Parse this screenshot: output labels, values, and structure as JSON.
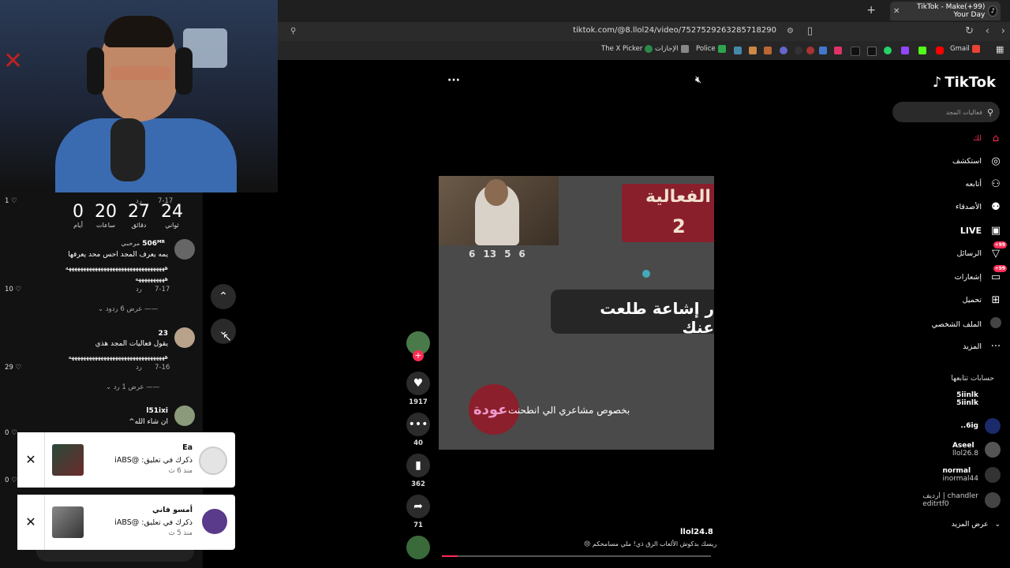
{
  "browser": {
    "tab_title": "(99+)TikTok - Make Your Day",
    "url": "tiktok.com/@8.llol24/video/7527529263285718290",
    "bookmarks": [
      "The X Picker",
      "الإجازات",
      "Police",
      "Gmail"
    ]
  },
  "webcam": {},
  "comments": {
    "countdown": [
      {
        "value": "24",
        "label": "ثواني"
      },
      {
        "value": "27",
        "label": "دقائق"
      },
      {
        "value": "20",
        "label": "ساعات"
      },
      {
        "value": "0",
        "label": "أيام"
      }
    ],
    "items": [
      {
        "top_date": "7-17",
        "reply": "رد",
        "likes": "1",
        "username": "506ᴹᴿ",
        "badge": "مرحبي",
        "line1": "يمه يعرف المجد احس محد يعرفها",
        "line2": "ههههههههههههههههههههههههههههههههههه",
        "line3": "ههههههههههه",
        "date": "7-17",
        "likes2": "10",
        "show_replies": "عرض 6 ردود"
      },
      {
        "username": "23",
        "line1": "يقول فعاليات المجد هذي",
        "line2": "هههههههههههههههههههههههههههههههههه",
        "date": "7-16",
        "reply": "رد",
        "likes": "29",
        "show_replies": "عرض 1 رد"
      },
      {
        "username": "l51ixi",
        "line1": "ان شاء الله^",
        "likes": "0"
      }
    ]
  },
  "notifications": [
    {
      "name": "Ea",
      "message": "ذكرك في تعليق: @iABS",
      "time": "منذ 6 ث"
    },
    {
      "name": "أمسو فاني",
      "message": "ذكرك في تعليق: @iABS",
      "time": "منذ 5 ث"
    }
  ],
  "video": {
    "title_line1": "الفعالية",
    "title_line2": "2",
    "countdown_small": [
      "6",
      "13",
      "5",
      "6"
    ],
    "bubble_text": "ر إشاعة طلعت عنك",
    "sticker_text": "عودة",
    "subtitle": "بخصوص مشاعري الي انطحنت",
    "author": "llol24.8",
    "description": "ريسك بدكوش الألعاب الزق ذي! ملي مسامحكم 😢",
    "progress": 0.06
  },
  "actions": {
    "likes": "1917",
    "comments": "40",
    "saves": "362",
    "shares": "71"
  },
  "sidebar": {
    "logo": "TikTok",
    "search_placeholder": "فعاليات المجد",
    "items": [
      {
        "label": "لك",
        "icon": "home-icon"
      },
      {
        "label": "استكشف",
        "icon": "compass-icon"
      },
      {
        "label": "أتابعه",
        "icon": "follow-icon"
      },
      {
        "label": "الأصدقاء",
        "icon": "friends-icon"
      },
      {
        "label": "LIVE",
        "icon": "live-icon"
      },
      {
        "label": "الرسائل",
        "icon": "messages-icon",
        "badge": "99+"
      },
      {
        "label": "إشعارات",
        "icon": "notifications-icon",
        "badge": "99+"
      },
      {
        "label": "تحميل",
        "icon": "upload-icon"
      },
      {
        "label": "الملف الشخصي",
        "icon": "profile-icon"
      },
      {
        "label": "المزيد",
        "icon": "more-icon"
      }
    ],
    "following_header": "حسابات تتابعها",
    "following": [
      {
        "name": "5iinlk",
        "sub": "5iinlk"
      },
      {
        "name": "6ig..",
        "sub": ""
      },
      {
        "name": "Aseel",
        "sub": "llol26.8"
      },
      {
        "name": "normal",
        "sub": "inormal44"
      },
      {
        "name": "chandler | ارديف",
        "sub": "editrtf0"
      }
    ],
    "show_more": "عرض المزيد"
  },
  "colors": {
    "accent": "#fe2c55",
    "panel": "#121212"
  }
}
